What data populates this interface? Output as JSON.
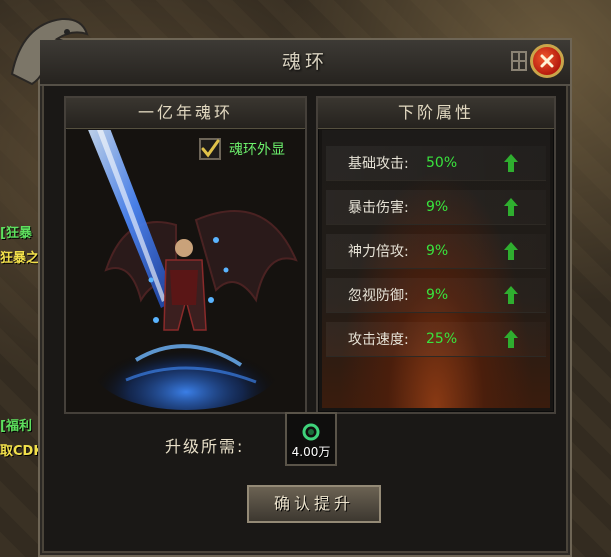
{
  "window": {
    "title": "魂环",
    "close_icon": "close-icon"
  },
  "left_panel": {
    "title": "一亿年魂环",
    "show_checkbox_label": "魂环外显",
    "show_checkbox_checked": true
  },
  "right_panel": {
    "title": "下阶属性",
    "stats": [
      {
        "name": "基础攻击:",
        "value": "50%",
        "icon": "arrow-up-icon"
      },
      {
        "name": "暴击伤害:",
        "value": "9%",
        "icon": "arrow-up-icon"
      },
      {
        "name": "神力倍攻:",
        "value": "9%",
        "icon": "arrow-up-icon"
      },
      {
        "name": "忽视防御:",
        "value": "9%",
        "icon": "arrow-up-icon"
      },
      {
        "name": "攻击速度:",
        "value": "25%",
        "icon": "arrow-up-icon"
      }
    ]
  },
  "upgrade": {
    "requirement_label": "升级所需:",
    "item_amount": "4.00万",
    "item_icon": "currency-icon",
    "confirm_label": "确认提升"
  },
  "background": {
    "side_texts": [
      "[狂暴",
      "狂暴之",
      "[福利",
      "取CDK"
    ]
  },
  "colors": {
    "stat_value": "#39e33d",
    "checkbox_label": "#6cf06c",
    "close_button": "#d32d17"
  }
}
